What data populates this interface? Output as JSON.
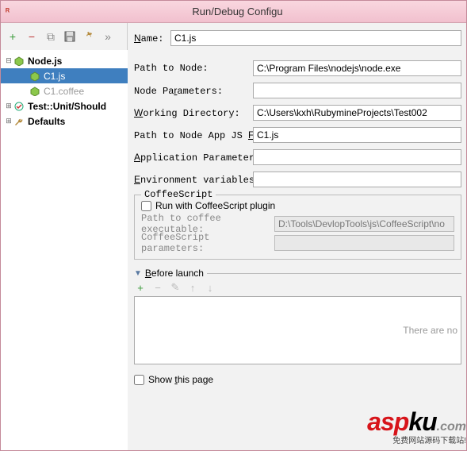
{
  "window": {
    "title": "Run/Debug Configu"
  },
  "toolbar": {
    "add": "+",
    "remove": "−",
    "copy": "⧉",
    "save": "💾",
    "wrench": "🔧",
    "expand": "»"
  },
  "tree": {
    "items": [
      {
        "depth": 0,
        "exp": "⊟",
        "icon": "node-icon",
        "label": "Node.js",
        "bold": true
      },
      {
        "depth": 1,
        "exp": "",
        "icon": "node-icon",
        "label": "C1.js",
        "selected": true
      },
      {
        "depth": 1,
        "exp": "",
        "icon": "node-icon",
        "label": "C1.coffee",
        "dim": true
      },
      {
        "depth": 0,
        "exp": "⊞",
        "icon": "test-icon",
        "label": "Test::Unit/Should",
        "bold": true
      },
      {
        "depth": 0,
        "exp": "⊞",
        "icon": "wrench-icon",
        "label": "Defaults",
        "bold": true
      }
    ]
  },
  "form": {
    "name_label": "Name:",
    "name_value": "C1.js",
    "path_node_label": "Path to Node:",
    "path_node_value": "C:\\Program Files\\nodejs\\node.exe",
    "node_params_label": "Node Parameters:",
    "node_params_value": "",
    "work_dir_label": "Working Directory:",
    "work_dir_value": "C:\\Users\\kxh\\RubymineProjects\\Test002",
    "app_file_label": "Path to Node App JS File:",
    "app_file_value": "C1.js",
    "app_params_label": "Application Parameters:",
    "app_params_value": "",
    "env_vars_label": "Environment variables:",
    "env_vars_value": ""
  },
  "coffee": {
    "legend": "CoffeeScript",
    "run_with_label": "Run with CoffeeScript plugin",
    "exe_label": "Path to coffee executable:",
    "exe_value": "D:\\Tools\\DevlopTools\\js\\CoffeeScript\\no",
    "params_label": "CoffeeScript parameters:",
    "params_value": ""
  },
  "before_launch": {
    "label": "Before launch",
    "empty_text": "There are no"
  },
  "bottom": {
    "show_page_label": "Show this page"
  },
  "watermark": {
    "brand1": "asp",
    "brand2": "ku",
    "tld": ".com",
    "sub": "免费网站源码下载站!"
  }
}
